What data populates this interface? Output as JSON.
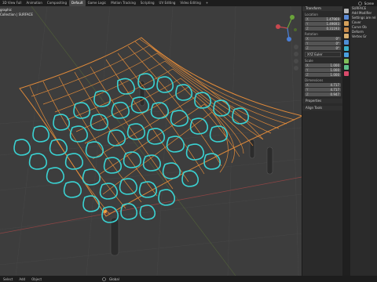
{
  "workspaces": [
    "3D View Full",
    "Animation",
    "Compositing",
    "Default",
    "Game Logic",
    "Motion Tracking",
    "Scripting",
    "UV Editing",
    "Video Editing"
  ],
  "active_workspace": "Default",
  "add_tab_glyph": "+",
  "scene": {
    "name": "Scene"
  },
  "viewport": {
    "perspective_label": "graphic",
    "collection_label": "Collection | SURFACE",
    "transform_orientation": "Global",
    "colors": {
      "surface_wire": "#e08a3a",
      "curve": "#3ad3d3",
      "floor_grid": "#4a4a4a",
      "x_axis": "#a04848",
      "y_axis": "#6a8f3a"
    }
  },
  "npanel": {
    "header": "Transform",
    "location_label": "Location",
    "location": [
      {
        "axis": "X",
        "value": "1.47969"
      },
      {
        "axis": "Y",
        "value": "1.49693"
      },
      {
        "axis": "Z",
        "value": "0.31193"
      }
    ],
    "rotation_label": "Rotation",
    "rotation": [
      {
        "axis": "X",
        "value": "0°"
      },
      {
        "axis": "Y",
        "value": "0°"
      },
      {
        "axis": "Z",
        "value": "0°"
      }
    ],
    "rotation_mode": "XYZ Euler",
    "scale_label": "Scale",
    "scale": [
      {
        "axis": "X",
        "value": "1.000"
      },
      {
        "axis": "Y",
        "value": "1.000"
      },
      {
        "axis": "Z",
        "value": "1.000"
      }
    ],
    "dimensions_label": "Dimensions",
    "dimensions": [
      {
        "axis": "X",
        "value": "4.717"
      },
      {
        "axis": "Y",
        "value": "4.717"
      },
      {
        "axis": "Z",
        "value": "0.947"
      }
    ],
    "subpanels": [
      "Properties",
      "Align Tools"
    ]
  },
  "properties": {
    "object_name": "SURFACE",
    "add_modifier": "Add Modifier",
    "rows": [
      "Settings are rel",
      "Cover",
      "Curve Ob",
      "Deform",
      "Vertex Gr"
    ]
  },
  "statusbar": {
    "items": [
      "Select",
      "Add",
      "Object"
    ]
  }
}
